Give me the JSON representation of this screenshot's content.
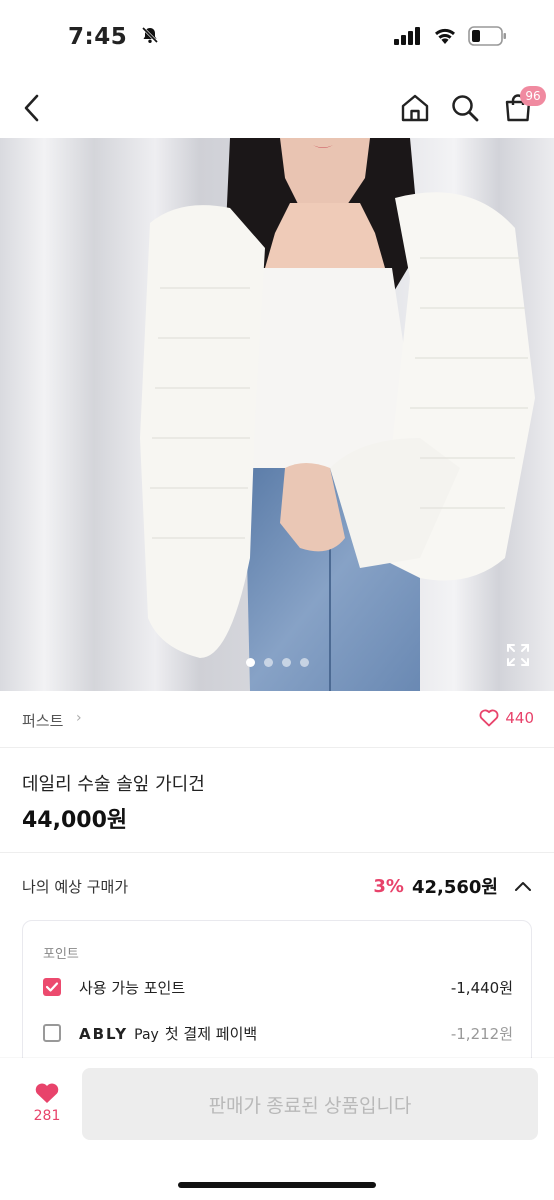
{
  "status_bar": {
    "time": "7:45",
    "icons": [
      "bell-slash-icon",
      "signal-icon",
      "wifi-icon",
      "battery-icon"
    ]
  },
  "top_nav": {
    "icons": [
      "back-icon",
      "home-icon",
      "search-icon",
      "cart-icon"
    ],
    "cart_badge": "96"
  },
  "gallery": {
    "page_count": 4,
    "active_index": 0
  },
  "brand": {
    "name": "퍼스트",
    "chevron": "›",
    "like_count": "440"
  },
  "product": {
    "name": "데일리 수술 솔잎 가디건",
    "price": "44,000원"
  },
  "estimated_purchase": {
    "label": "나의 예상 구매가",
    "discount": "3%",
    "price": "42,560원"
  },
  "points": {
    "title": "포인트",
    "rows": [
      {
        "label": "사용 가능 포인트",
        "value": "-1,440원",
        "checked": true
      },
      {
        "logo": "ABLY",
        "logo_suffix": "Pay",
        "label": "첫 결제 페이백",
        "value": "-1,212원",
        "checked": false
      }
    ]
  },
  "bottom_bar": {
    "favorite_count": "281",
    "buy_label": "판매가 종료된 상품입니다"
  },
  "colors": {
    "accent": "#e8436b",
    "checkbox_checked": "#ec4a6e",
    "badge": "#f08aa0",
    "disabled_button": "#ededed"
  }
}
